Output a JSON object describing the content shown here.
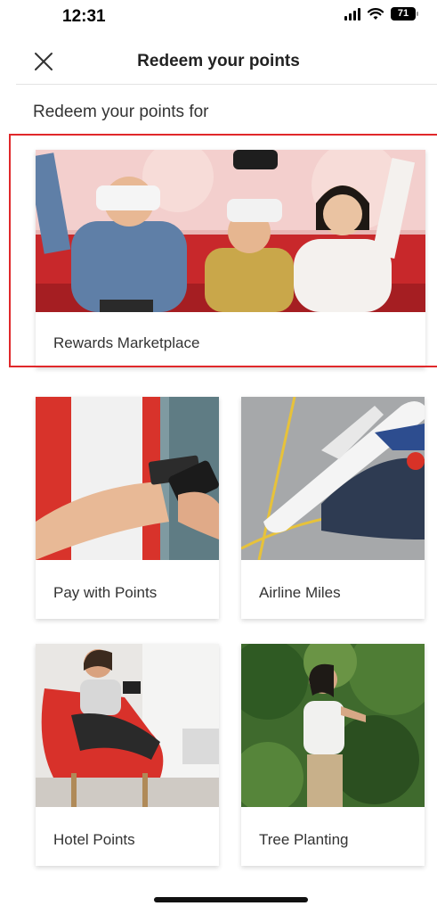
{
  "status": {
    "time": "12:31",
    "battery": "71"
  },
  "header": {
    "title": "Redeem your points",
    "close_icon": "close-icon"
  },
  "section": {
    "title": "Redeem your points for"
  },
  "options": [
    {
      "label": "Rewards Marketplace",
      "image": "family-vr-gaming-photo",
      "highlighted": true
    },
    {
      "label": "Pay with Points",
      "image": "card-and-phone-photo"
    },
    {
      "label": "Airline Miles",
      "image": "airplane-photo"
    },
    {
      "label": "Hotel Points",
      "image": "woman-in-red-chair-photo"
    },
    {
      "label": "Tree Planting",
      "image": "woman-among-trees-photo"
    }
  ],
  "colors": {
    "highlight": "#e0282b",
    "divider": "#e3e3e3"
  }
}
